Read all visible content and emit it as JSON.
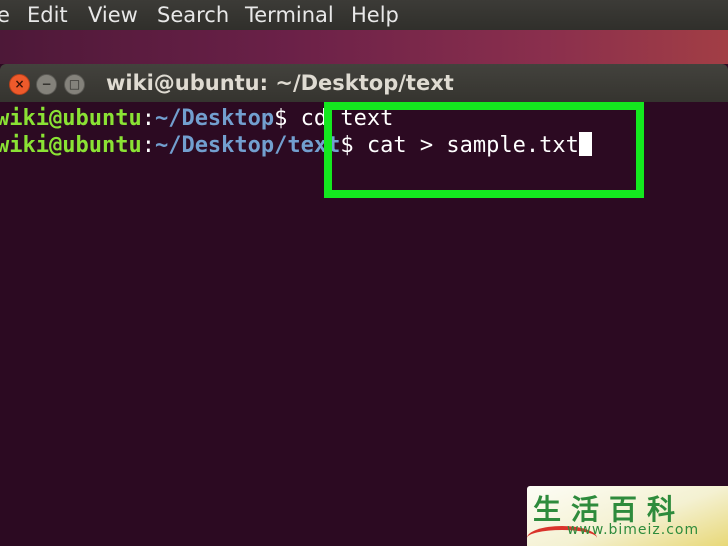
{
  "menubar": {
    "items": [
      {
        "label": "e"
      },
      {
        "label": "Edit"
      },
      {
        "label": "View"
      },
      {
        "label": "Search"
      },
      {
        "label": "Terminal"
      },
      {
        "label": "Help"
      }
    ]
  },
  "window": {
    "title": "wiki@ubuntu: ~/Desktop/text",
    "close_glyph": "×",
    "minimize_glyph": "−",
    "maximize_glyph": "□"
  },
  "terminal": {
    "lines": [
      {
        "user": "wiki@ubuntu",
        "colon": ":",
        "path": "~/Desktop",
        "prompt": "$ ",
        "command": "cd text"
      },
      {
        "user": "wiki@ubuntu",
        "colon": ":",
        "path": "~/Desktop/text",
        "prompt": "$ ",
        "command": "cat > sample.txt"
      }
    ]
  },
  "colors": {
    "terminal_bg": "#2c0a22",
    "user_green": "#8ae234",
    "path_blue": "#729fcf",
    "highlight_green": "#14e81f"
  },
  "watermark": {
    "chars": "生活百科",
    "url": "www.bimeiz.com"
  }
}
